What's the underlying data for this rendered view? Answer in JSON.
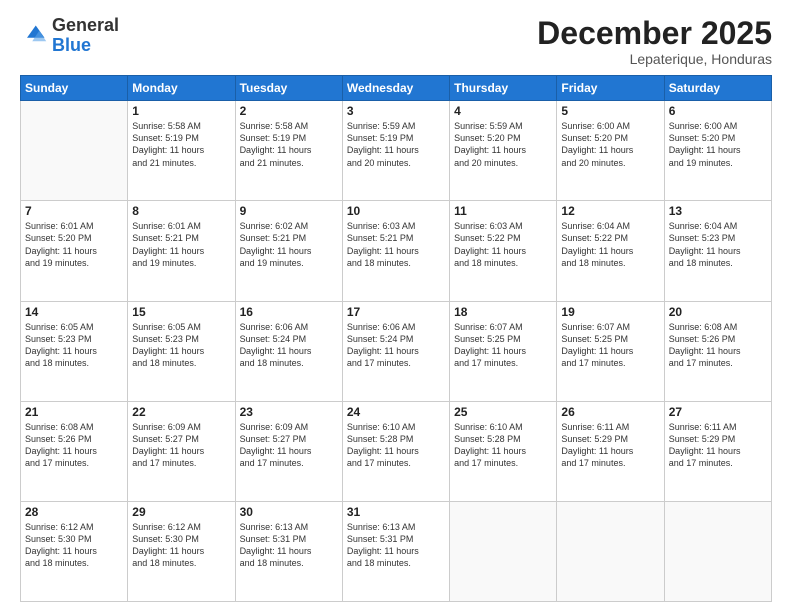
{
  "header": {
    "logo": {
      "general": "General",
      "blue": "Blue"
    },
    "title": "December 2025",
    "subtitle": "Lepaterique, Honduras"
  },
  "calendar": {
    "weekdays": [
      "Sunday",
      "Monday",
      "Tuesday",
      "Wednesday",
      "Thursday",
      "Friday",
      "Saturday"
    ],
    "weeks": [
      [
        {
          "day": "",
          "detail": ""
        },
        {
          "day": "1",
          "detail": "Sunrise: 5:58 AM\nSunset: 5:19 PM\nDaylight: 11 hours\nand 21 minutes."
        },
        {
          "day": "2",
          "detail": "Sunrise: 5:58 AM\nSunset: 5:19 PM\nDaylight: 11 hours\nand 21 minutes."
        },
        {
          "day": "3",
          "detail": "Sunrise: 5:59 AM\nSunset: 5:19 PM\nDaylight: 11 hours\nand 20 minutes."
        },
        {
          "day": "4",
          "detail": "Sunrise: 5:59 AM\nSunset: 5:20 PM\nDaylight: 11 hours\nand 20 minutes."
        },
        {
          "day": "5",
          "detail": "Sunrise: 6:00 AM\nSunset: 5:20 PM\nDaylight: 11 hours\nand 20 minutes."
        },
        {
          "day": "6",
          "detail": "Sunrise: 6:00 AM\nSunset: 5:20 PM\nDaylight: 11 hours\nand 19 minutes."
        }
      ],
      [
        {
          "day": "7",
          "detail": "Sunrise: 6:01 AM\nSunset: 5:20 PM\nDaylight: 11 hours\nand 19 minutes."
        },
        {
          "day": "8",
          "detail": "Sunrise: 6:01 AM\nSunset: 5:21 PM\nDaylight: 11 hours\nand 19 minutes."
        },
        {
          "day": "9",
          "detail": "Sunrise: 6:02 AM\nSunset: 5:21 PM\nDaylight: 11 hours\nand 19 minutes."
        },
        {
          "day": "10",
          "detail": "Sunrise: 6:03 AM\nSunset: 5:21 PM\nDaylight: 11 hours\nand 18 minutes."
        },
        {
          "day": "11",
          "detail": "Sunrise: 6:03 AM\nSunset: 5:22 PM\nDaylight: 11 hours\nand 18 minutes."
        },
        {
          "day": "12",
          "detail": "Sunrise: 6:04 AM\nSunset: 5:22 PM\nDaylight: 11 hours\nand 18 minutes."
        },
        {
          "day": "13",
          "detail": "Sunrise: 6:04 AM\nSunset: 5:23 PM\nDaylight: 11 hours\nand 18 minutes."
        }
      ],
      [
        {
          "day": "14",
          "detail": "Sunrise: 6:05 AM\nSunset: 5:23 PM\nDaylight: 11 hours\nand 18 minutes."
        },
        {
          "day": "15",
          "detail": "Sunrise: 6:05 AM\nSunset: 5:23 PM\nDaylight: 11 hours\nand 18 minutes."
        },
        {
          "day": "16",
          "detail": "Sunrise: 6:06 AM\nSunset: 5:24 PM\nDaylight: 11 hours\nand 18 minutes."
        },
        {
          "day": "17",
          "detail": "Sunrise: 6:06 AM\nSunset: 5:24 PM\nDaylight: 11 hours\nand 17 minutes."
        },
        {
          "day": "18",
          "detail": "Sunrise: 6:07 AM\nSunset: 5:25 PM\nDaylight: 11 hours\nand 17 minutes."
        },
        {
          "day": "19",
          "detail": "Sunrise: 6:07 AM\nSunset: 5:25 PM\nDaylight: 11 hours\nand 17 minutes."
        },
        {
          "day": "20",
          "detail": "Sunrise: 6:08 AM\nSunset: 5:26 PM\nDaylight: 11 hours\nand 17 minutes."
        }
      ],
      [
        {
          "day": "21",
          "detail": "Sunrise: 6:08 AM\nSunset: 5:26 PM\nDaylight: 11 hours\nand 17 minutes."
        },
        {
          "day": "22",
          "detail": "Sunrise: 6:09 AM\nSunset: 5:27 PM\nDaylight: 11 hours\nand 17 minutes."
        },
        {
          "day": "23",
          "detail": "Sunrise: 6:09 AM\nSunset: 5:27 PM\nDaylight: 11 hours\nand 17 minutes."
        },
        {
          "day": "24",
          "detail": "Sunrise: 6:10 AM\nSunset: 5:28 PM\nDaylight: 11 hours\nand 17 minutes."
        },
        {
          "day": "25",
          "detail": "Sunrise: 6:10 AM\nSunset: 5:28 PM\nDaylight: 11 hours\nand 17 minutes."
        },
        {
          "day": "26",
          "detail": "Sunrise: 6:11 AM\nSunset: 5:29 PM\nDaylight: 11 hours\nand 17 minutes."
        },
        {
          "day": "27",
          "detail": "Sunrise: 6:11 AM\nSunset: 5:29 PM\nDaylight: 11 hours\nand 17 minutes."
        }
      ],
      [
        {
          "day": "28",
          "detail": "Sunrise: 6:12 AM\nSunset: 5:30 PM\nDaylight: 11 hours\nand 18 minutes."
        },
        {
          "day": "29",
          "detail": "Sunrise: 6:12 AM\nSunset: 5:30 PM\nDaylight: 11 hours\nand 18 minutes."
        },
        {
          "day": "30",
          "detail": "Sunrise: 6:13 AM\nSunset: 5:31 PM\nDaylight: 11 hours\nand 18 minutes."
        },
        {
          "day": "31",
          "detail": "Sunrise: 6:13 AM\nSunset: 5:31 PM\nDaylight: 11 hours\nand 18 minutes."
        },
        {
          "day": "",
          "detail": ""
        },
        {
          "day": "",
          "detail": ""
        },
        {
          "day": "",
          "detail": ""
        }
      ]
    ]
  }
}
